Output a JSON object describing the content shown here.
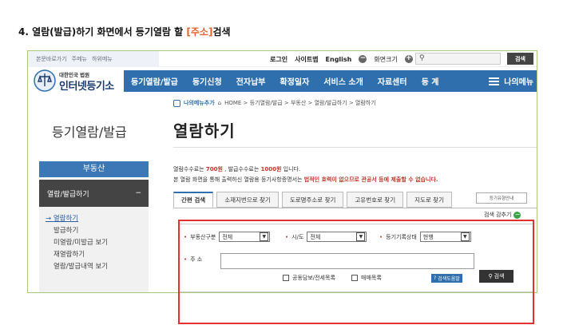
{
  "step_title": {
    "prefix": "4. 열람(발급)하기 화면에서 등기열람 할 ",
    "highlight": "[주소]",
    "suffix": "검색"
  },
  "utility": {
    "left_links": [
      "본문바로가기",
      "주메뉴",
      "하위메뉴"
    ],
    "login": "로그인",
    "sitemap": "사이트맵",
    "english": "English",
    "zoom_label": "화면크기",
    "search_button": "검색"
  },
  "logo": {
    "sub": "대한민국 법원",
    "main": "인터넷등기소"
  },
  "nav": {
    "items": [
      "등기열람/발급",
      "등기신청",
      "전자납부",
      "확정일자",
      "서비스 소개",
      "자료센터",
      "등 계"
    ],
    "my_menu": "나의메뉴"
  },
  "breadcrumb": {
    "my_menu_add": "나의메뉴추가",
    "path": "HOME > 등기열람/발급 > 부동산 > 열람/발급하기 > 열람하기"
  },
  "sidebar": {
    "title": "등기열람/발급",
    "section": "부동산",
    "group": "열람/발급하기",
    "group_toggle": "−",
    "items": [
      "열람하기",
      "발급하기",
      "미열람/미발급 보기",
      "재열람하기",
      "열람/발급내역 보기"
    ]
  },
  "page": {
    "title": "열람하기",
    "fee_line_1": {
      "a": "열람수수료는 ",
      "b": "700원",
      "c": " , 발급수수료는 ",
      "d": "1000원",
      "e": " 입니다."
    },
    "fee_line_2": {
      "a": "본 열람 화면을 통해 출력하신 열람용 등기사항증명서는 ",
      "b": "법적인 효력이 없으므로 관공서 등에 제출할 수 없습니다."
    }
  },
  "tabs": [
    "간편 검색",
    "소재지번으로 찾기",
    "도로명주소로 찾기",
    "고유번호로 찾기",
    "지도로 찾기"
  ],
  "register_button": "등기유형안내",
  "fold_label": "검색 감추기",
  "form": {
    "type_label": "부동산구분",
    "type_value": "전체",
    "region_label": "시/도",
    "region_value": "전체",
    "status_label": "등기기록상태",
    "status_value": "현행",
    "address_label": "주 소",
    "address_value": "",
    "check_1": "공동담보/전세목록",
    "check_2": "매매목록",
    "help_button": "검색도움말",
    "search_button": "검색"
  }
}
